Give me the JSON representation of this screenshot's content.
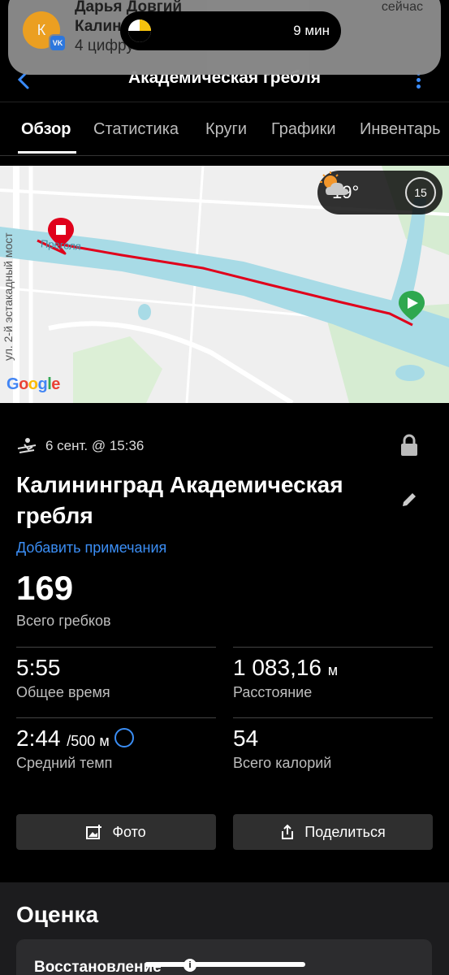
{
  "notification": {
    "avatar_letter": "К",
    "badge": "VK",
    "sender": "Дарья Довгий",
    "line2": "Калин",
    "line3": "4 цифру",
    "time": "сейчас"
  },
  "dynamic_island": {
    "text": "9 мин"
  },
  "header": {
    "title": "Академическая гребля"
  },
  "tabs": [
    "Обзор",
    "Статистика",
    "Круги",
    "Графики",
    "Инвентарь"
  ],
  "map": {
    "temperature": "19°",
    "badge_value": "15",
    "road_label": "ул. 2-й эстакадный мост",
    "water_label": "Преголя",
    "provider": "Google"
  },
  "activity": {
    "date": "6 сент. @ 15:36",
    "title": "Калининград Академическая гребля",
    "add_notes": "Добавить примечания",
    "strokes_value": "169",
    "strokes_label": "Всего гребков",
    "time_value": "5:55",
    "time_label": "Общее время",
    "distance_value": "1 083,16",
    "distance_unit": "м",
    "distance_label": "Расстояние",
    "pace_value": "2:44",
    "pace_unit": "/500 м",
    "pace_label": "Средний темп",
    "calories_value": "54",
    "calories_label": "Всего калорий"
  },
  "buttons": {
    "photo": "Фото",
    "share": "Поделиться"
  },
  "rating": {
    "title": "Оценка",
    "first_item": "Восстановление"
  },
  "colors": {
    "accent": "#3b8ef5",
    "route": "#e0001b",
    "water": "#a8dbe6",
    "start": "#2fa84f"
  }
}
